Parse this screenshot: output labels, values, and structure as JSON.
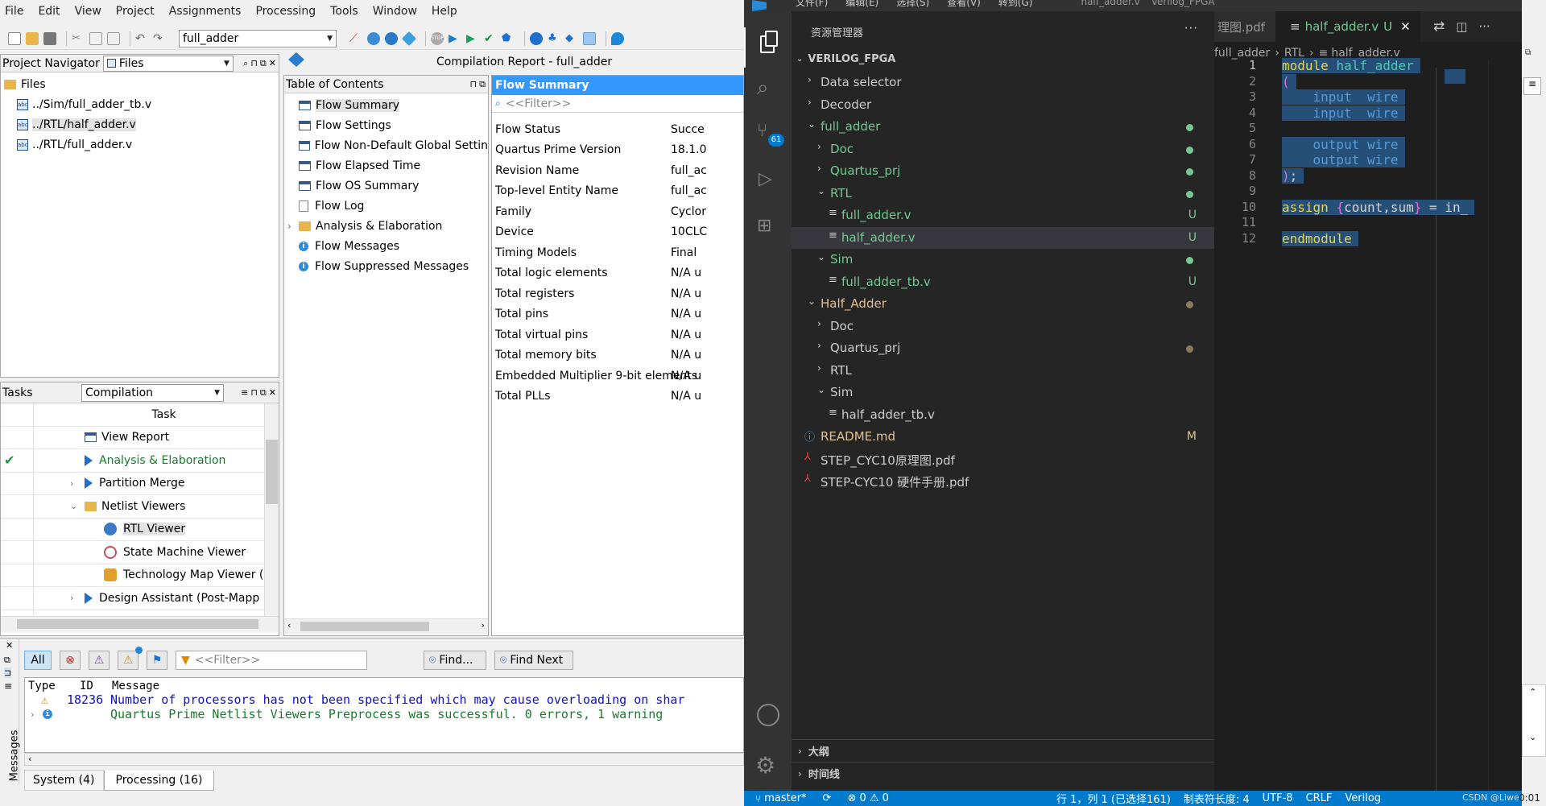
{
  "quartus": {
    "menu": [
      "File",
      "Edit",
      "View",
      "Project",
      "Assignments",
      "Processing",
      "Tools",
      "Window",
      "Help"
    ],
    "revision": "full_adder",
    "navigator": {
      "title": "Project Navigator",
      "view": "Files",
      "root": "Files",
      "files": [
        "../Sim/full_adder_tb.v",
        "../RTL/half_adder.v",
        "../RTL/full_adder.v"
      ]
    },
    "report_title": "Compilation Report - full_adder",
    "toc": {
      "title": "Table of Contents",
      "items": [
        "Flow Summary",
        "Flow Settings",
        "Flow Non-Default Global Settin",
        "Flow Elapsed Time",
        "Flow OS Summary",
        "Flow Log",
        "Analysis & Elaboration",
        "Flow Messages",
        "Flow Suppressed Messages"
      ]
    },
    "summary": {
      "header": "Flow Summary",
      "filter": "<<Filter>>",
      "rows": [
        {
          "k": "Flow Status",
          "v": "Succe"
        },
        {
          "k": "Quartus Prime Version",
          "v": "18.1.0"
        },
        {
          "k": "Revision Name",
          "v": "full_ac"
        },
        {
          "k": "Top-level Entity Name",
          "v": "full_ac"
        },
        {
          "k": "Family",
          "v": "Cyclor"
        },
        {
          "k": "Device",
          "v": "10CLC"
        },
        {
          "k": "Timing Models",
          "v": "Final"
        },
        {
          "k": "Total logic elements",
          "v": "N/A u"
        },
        {
          "k": "Total registers",
          "v": "N/A u"
        },
        {
          "k": "Total pins",
          "v": "N/A u"
        },
        {
          "k": "Total virtual pins",
          "v": "N/A u"
        },
        {
          "k": "Total memory bits",
          "v": "N/A u"
        },
        {
          "k": "Embedded Multiplier 9-bit elements",
          "v": "N/A u"
        },
        {
          "k": "Total PLLs",
          "v": "N/A u"
        }
      ]
    },
    "tasks": {
      "title": "Tasks",
      "flow": "Compilation",
      "header": "Task",
      "items": [
        "View Report",
        "Analysis & Elaboration",
        "Partition Merge",
        "Netlist Viewers",
        "RTL Viewer",
        "State Machine Viewer",
        "Technology Map Viewer (",
        "Design Assistant (Post-Mapp"
      ]
    },
    "messages": {
      "all": "All",
      "filter": "<<Filter>>",
      "find": "Find...",
      "find_next": "Find Next",
      "col_type": "Type",
      "col_id": "ID",
      "col_message": "Message",
      "rows": [
        {
          "id": "18236",
          "text": "Number of processors has not been specified which may cause overloading on shar"
        },
        {
          "id": "",
          "text": "Quartus Prime Netlist Viewers Preprocess was successful. 0 errors, 1 warning"
        }
      ],
      "side_label": "Messages",
      "tabs": [
        "System (4)",
        "Processing (16)"
      ]
    }
  },
  "vscode": {
    "title_items": [
      "文件(F)",
      "编辑(E)",
      "选择(S)",
      "查看(V)",
      "转到(G)",
      "half_adder.v",
      "Verilog_FPGA"
    ],
    "scm_badge": "61",
    "explorer_title": "资源管理器",
    "explorer_more": "···",
    "root": "VERILOG_FPGA",
    "tree": [
      {
        "label": "Data selector",
        "depth": 0,
        "chev": "right"
      },
      {
        "label": "Decoder",
        "depth": 0,
        "chev": "right"
      },
      {
        "label": "full_adder",
        "depth": 0,
        "chev": "down",
        "color": "#73c991",
        "dot": "#73c991"
      },
      {
        "label": "Doc",
        "depth": 1,
        "chev": "right",
        "color": "#73c991",
        "dot": "#73c991"
      },
      {
        "label": "Quartus_prj",
        "depth": 1,
        "chev": "right",
        "color": "#73c991",
        "dot": "#73c991"
      },
      {
        "label": "RTL",
        "depth": 1,
        "chev": "down",
        "color": "#73c991",
        "dot": "#73c991"
      },
      {
        "label": "full_adder.v",
        "depth": 2,
        "file": true,
        "color": "#73c991",
        "badge": "U"
      },
      {
        "label": "half_adder.v",
        "depth": 2,
        "file": true,
        "color": "#73c991",
        "badge": "U",
        "selected": true
      },
      {
        "label": "Sim",
        "depth": 1,
        "chev": "down",
        "color": "#73c991",
        "dot": "#73c991"
      },
      {
        "label": "full_adder_tb.v",
        "depth": 2,
        "file": true,
        "color": "#73c991",
        "badge": "U"
      },
      {
        "label": "Half_Adder",
        "depth": 0,
        "chev": "down",
        "color": "#e2c08d",
        "dot": "#8a7a5a"
      },
      {
        "label": "Doc",
        "depth": 1,
        "chev": "right"
      },
      {
        "label": "Quartus_prj",
        "depth": 1,
        "chev": "right",
        "dot": "#8a7a5a"
      },
      {
        "label": "RTL",
        "depth": 1,
        "chev": "right"
      },
      {
        "label": "Sim",
        "depth": 1,
        "chev": "down"
      },
      {
        "label": "half_adder_tb.v",
        "depth": 2,
        "file": true
      },
      {
        "label": "README.md",
        "depth": 0,
        "icon": "info",
        "color": "#e2c08d",
        "badge": "M"
      },
      {
        "label": "STEP_CYC10原理图.pdf",
        "depth": 0,
        "icon": "pdf"
      },
      {
        "label": "STEP-CYC10 硬件手册.pdf",
        "depth": 0,
        "icon": "pdf"
      }
    ],
    "outline": "大纲",
    "timeline": "时间线",
    "tab_prev": "理图.pdf",
    "tab_active": "half_adder.v",
    "tab_active_badge": "U",
    "breadcrumb": [
      "full_adder",
      "RTL",
      "half_adder.v"
    ],
    "code": [
      {
        "n": "1",
        "t": "module half_adder"
      },
      {
        "n": "2",
        "t": "("
      },
      {
        "n": "3",
        "t": "    input  wire"
      },
      {
        "n": "4",
        "t": "    input  wire"
      },
      {
        "n": "5",
        "t": ""
      },
      {
        "n": "6",
        "t": "    output wire"
      },
      {
        "n": "7",
        "t": "    output wire"
      },
      {
        "n": "8",
        "t": ");"
      },
      {
        "n": "9",
        "t": ""
      },
      {
        "n": "10",
        "t": "assign {count,sum} = in_"
      },
      {
        "n": "11",
        "t": ""
      },
      {
        "n": "12",
        "t": "endmodule"
      }
    ],
    "status": {
      "branch": "master*",
      "problems": "⊗ 0 ⚠ 0",
      "position": "行 1，列 1 (已选择161)",
      "tab_size": "制表符长度: 4",
      "encoding": "UTF-8",
      "eol": "CRLF",
      "language": "Verilog"
    }
  },
  "watermark": "CSDN @Liwe",
  "clock": "0:01"
}
